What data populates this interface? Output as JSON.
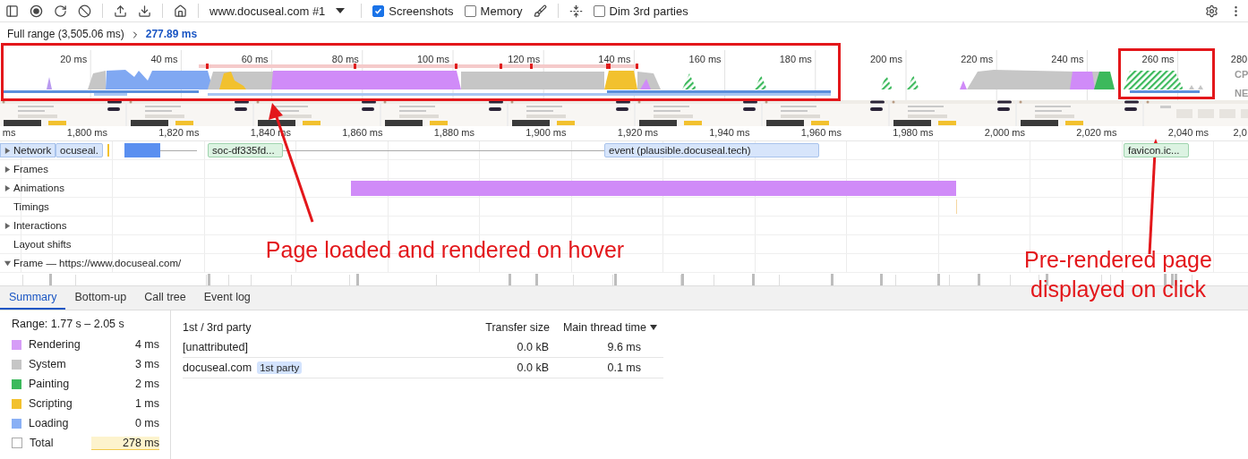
{
  "toolbar": {
    "target": "www.docuseal.com #1",
    "checkboxes": [
      {
        "label": "Screenshots",
        "checked": true
      },
      {
        "label": "Memory",
        "checked": false
      },
      {
        "label": "Dim 3rd parties",
        "checked": false
      }
    ]
  },
  "breadcrumb": {
    "parent": "Full range (3,505.06 ms)",
    "current": "277.89 ms"
  },
  "overview": {
    "ticks": [
      "20 ms",
      "40 ms",
      "60 ms",
      "80 ms",
      "100 ms",
      "120 ms",
      "140 ms",
      "160 ms",
      "180 ms",
      "200 ms",
      "220 ms",
      "240 ms",
      "260 ms",
      "280"
    ],
    "lanes": [
      "CP",
      "NE"
    ]
  },
  "timeline": {
    "ticks": [
      "ms",
      "1,800 ms",
      "1,820 ms",
      "1,840 ms",
      "1,860 ms",
      "1,880 ms",
      "1,900 ms",
      "1,920 ms",
      "1,940 ms",
      "1,960 ms",
      "1,980 ms",
      "2,000 ms",
      "2,020 ms",
      "2,040 ms",
      "2,0"
    ],
    "tracks": [
      {
        "label": "Network",
        "expanded": false
      },
      {
        "label": "Frames",
        "expanded": false
      },
      {
        "label": "Animations",
        "expanded": false
      },
      {
        "label": "Timings"
      },
      {
        "label": "Interactions",
        "expanded": false
      },
      {
        "label": "Layout shifts"
      },
      {
        "label": "Frame — https://www.docuseal.com/",
        "expanded": true
      }
    ],
    "network_requests": [
      {
        "label": "ocuseal.",
        "color": "#d7e5fb"
      },
      {
        "label": "soc-df335fd...",
        "color": "#dcf3e2"
      },
      {
        "label": "event (plausible.docuseal.tech)",
        "color": "#d7e5fb"
      },
      {
        "label": "favicon.ic...",
        "color": "#dcf3e2"
      }
    ]
  },
  "tabs": [
    {
      "label": "Summary",
      "selected": true
    },
    {
      "label": "Bottom-up",
      "selected": false
    },
    {
      "label": "Call tree",
      "selected": false
    },
    {
      "label": "Event log",
      "selected": false
    }
  ],
  "summary": {
    "range": "Range: 1.77 s – 2.05 s",
    "categories": [
      {
        "label": "Rendering",
        "value": "4 ms",
        "color": "#d69df7"
      },
      {
        "label": "System",
        "value": "3 ms",
        "color": "#c6c6c6"
      },
      {
        "label": "Painting",
        "value": "2 ms",
        "color": "#3cb95c"
      },
      {
        "label": "Scripting",
        "value": "1 ms",
        "color": "#f2c12e"
      },
      {
        "label": "Loading",
        "value": "0 ms",
        "color": "#8ab0f5"
      }
    ],
    "total": {
      "label": "Total",
      "value": "278 ms"
    }
  },
  "table": {
    "columns": [
      {
        "label": "1st / 3rd party",
        "sorted": false
      },
      {
        "label": "Transfer size",
        "sorted": false
      },
      {
        "label": "Main thread time",
        "sorted": true
      }
    ],
    "rows": [
      {
        "name": "[unattributed]",
        "transfer_size": "0.0 kB",
        "main_thread_time": "9.6 ms"
      },
      {
        "name": "docuseal.com",
        "badge": "1st party",
        "transfer_size": "0.0 kB",
        "main_thread_time": "0.1 ms"
      }
    ]
  },
  "annotations": [
    {
      "text": "Page loaded and rendered on hover"
    },
    {
      "text": "Pre-rendered page displayed on click"
    }
  ]
}
